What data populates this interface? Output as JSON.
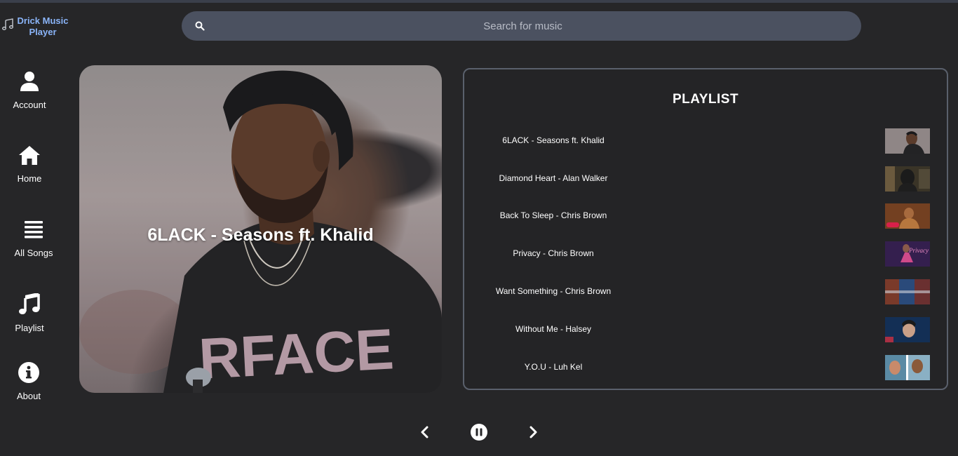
{
  "app": {
    "title": "Drick Music Player"
  },
  "search": {
    "placeholder": "Search for music",
    "value": ""
  },
  "sidebar": {
    "items": [
      {
        "label": "Account",
        "icon": "user-icon"
      },
      {
        "label": "Home",
        "icon": "home-icon"
      },
      {
        "label": "All Songs",
        "icon": "list-icon"
      },
      {
        "label": "Playlist",
        "icon": "music-note-icon"
      },
      {
        "label": "About",
        "icon": "info-icon"
      }
    ]
  },
  "now_playing": {
    "title": "6LACK - Seasons ft. Khalid"
  },
  "playlist": {
    "heading": "PLAYLIST",
    "tracks": [
      {
        "name": "6LACK - Seasons ft. Khalid"
      },
      {
        "name": "Diamond Heart - Alan Walker"
      },
      {
        "name": "Back To Sleep - Chris Brown"
      },
      {
        "name": "Privacy - Chris Brown"
      },
      {
        "name": "Want Something - Chris Brown"
      },
      {
        "name": "Without Me - Halsey"
      },
      {
        "name": "Y.O.U - Luh Kel"
      }
    ]
  },
  "controls": {
    "previous": "chevron-left-icon",
    "play_pause": "pause-icon",
    "next": "chevron-right-icon"
  },
  "colors": {
    "background": "#262628",
    "accent": "#8ab4f8",
    "search_bg": "#4b5160",
    "panel_border": "#5a606c"
  }
}
